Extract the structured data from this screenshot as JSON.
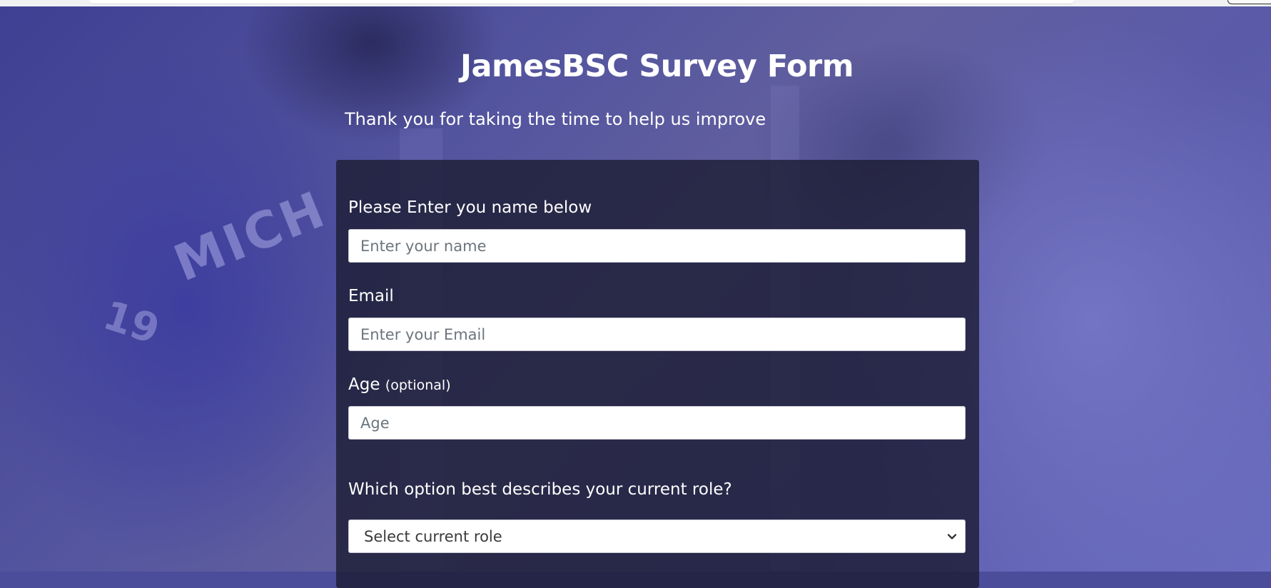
{
  "survey": {
    "title": "JamesBSC Survey Form",
    "description": "Thank you for taking the time to help us improve"
  },
  "form": {
    "name": {
      "label": "Please Enter you name below",
      "placeholder": "Enter your name"
    },
    "email": {
      "label": "Email",
      "placeholder": "Enter your Email"
    },
    "age": {
      "label": "Age",
      "clue": "(optional)",
      "placeholder": "Age"
    },
    "role": {
      "label": "Which option best describes your current role?",
      "selected": "Select current role"
    }
  },
  "background": {
    "jersey_text": "MICH",
    "jersey_number": "19"
  },
  "icons": {
    "select_arrow": "chevron-down-icon"
  },
  "colors": {
    "background_tint": "#4b4c9a",
    "form_card": "#1b1b32",
    "text": "#ffffff"
  }
}
